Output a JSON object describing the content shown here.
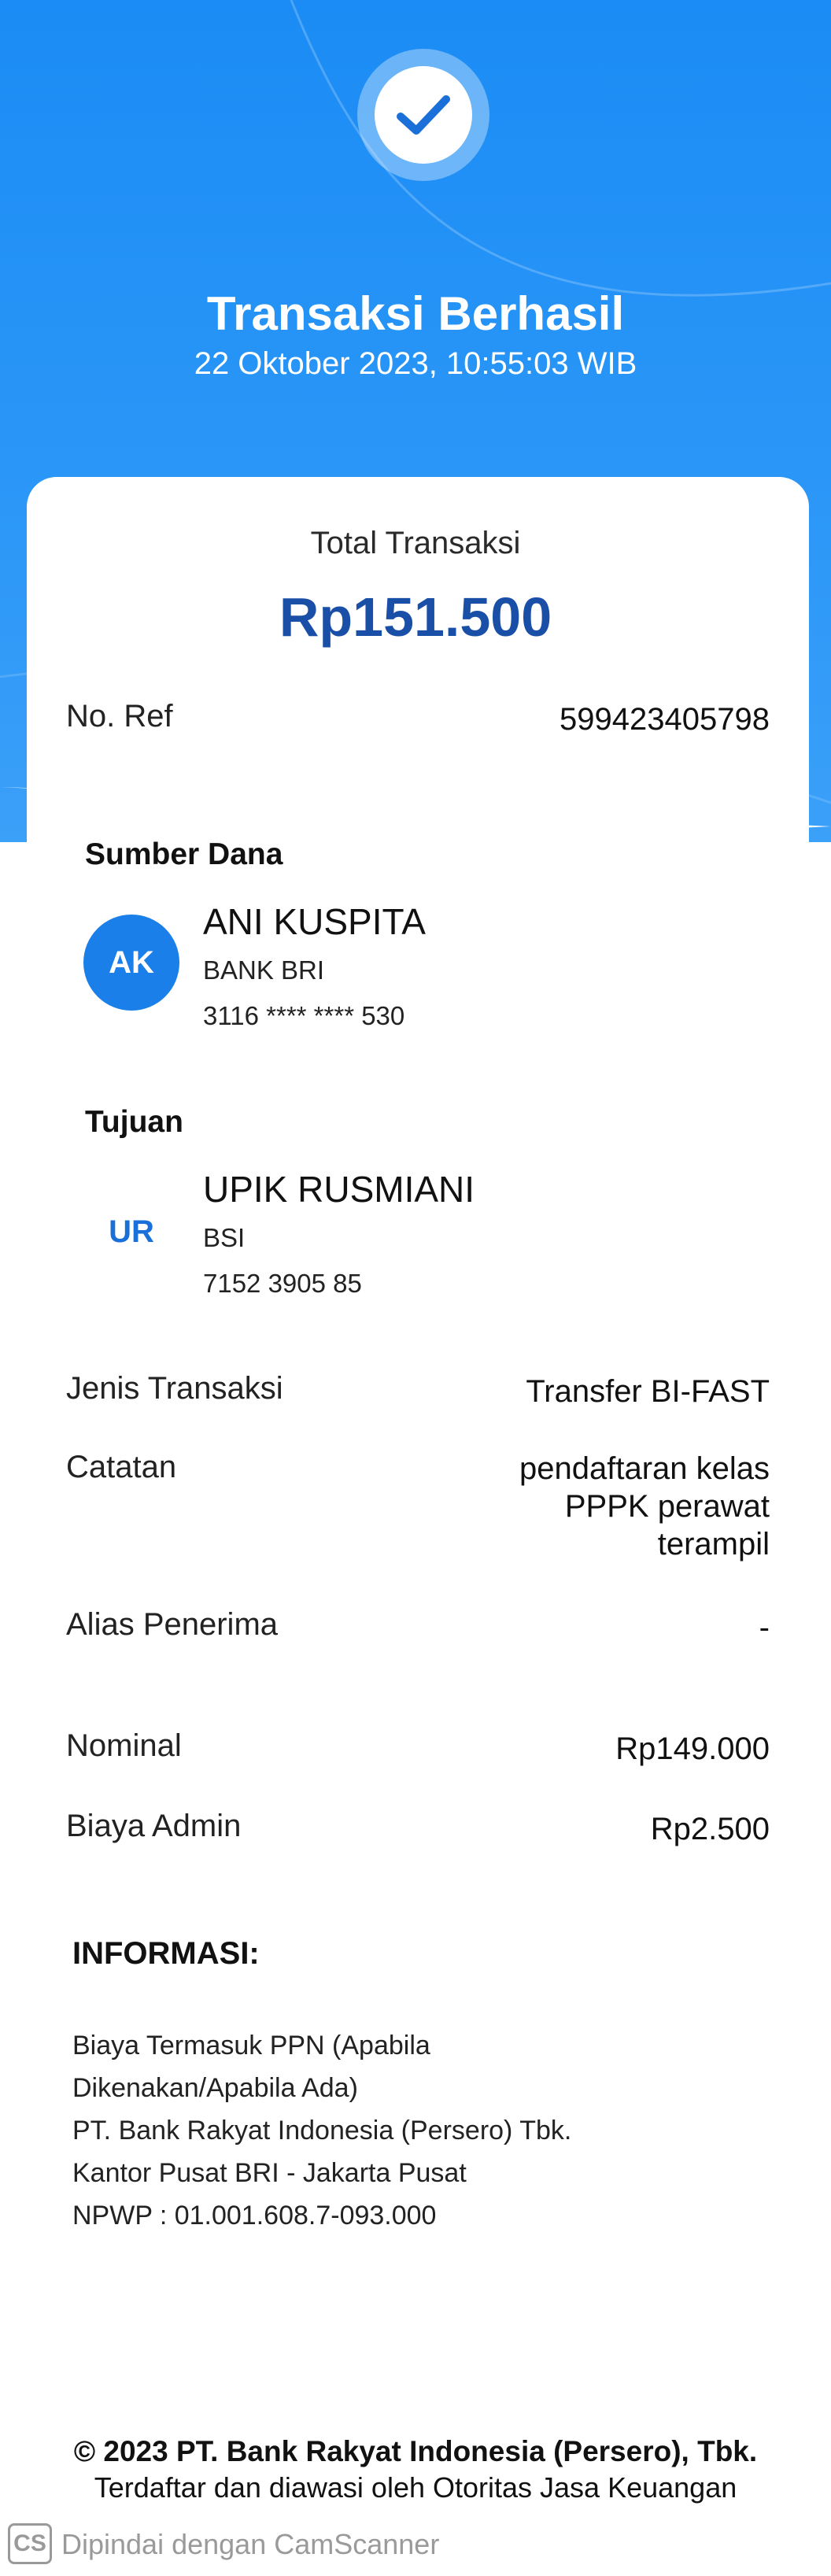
{
  "header": {
    "title": "Transaksi Berhasil",
    "datetime": "22 Oktober 2023, 10:55:03 WIB",
    "status_icon": "check-icon"
  },
  "summary": {
    "total_label": "Total Transaksi",
    "total_amount": "Rp151.500",
    "ref_label": "No. Ref",
    "ref_value": "599423405798"
  },
  "source": {
    "section_title": "Sumber Dana",
    "initials": "AK",
    "name": "ANI KUSPITA",
    "bank": "BANK BRI",
    "account": "3116 **** **** 530"
  },
  "destination": {
    "section_title": "Tujuan",
    "initials": "UR",
    "name": "UPIK RUSMIANI",
    "bank": "BSI",
    "account": "7152 3905 85"
  },
  "details": {
    "type_label": "Jenis Transaksi",
    "type_value": "Transfer BI-FAST",
    "note_label": "Catatan",
    "note_lines": [
      "pendaftaran kelas",
      "PPPK perawat",
      "terampil"
    ],
    "alias_label": "Alias Penerima",
    "alias_value": "-",
    "nominal_label": "Nominal",
    "nominal_value": "Rp149.000",
    "admin_label": "Biaya Admin",
    "admin_value": "Rp2.500"
  },
  "info": {
    "title": "INFORMASI:",
    "lines": [
      "Biaya Termasuk PPN (Apabila",
      "Dikenakan/Apabila Ada)",
      "PT. Bank Rakyat Indonesia (Persero) Tbk.",
      "Kantor Pusat BRI - Jakarta Pusat",
      "NPWP : 01.001.608.7-093.000"
    ]
  },
  "footer": {
    "copyright": "© 2023 PT. Bank Rakyat Indonesia (Persero), Tbk.",
    "regulator": "Terdaftar dan diawasi oleh Otoritas Jasa Keuangan"
  },
  "watermark": {
    "badge": "CS",
    "text": "Dipindai dengan CamScanner"
  },
  "colors": {
    "header_blue": "#1b8cf5",
    "amount_blue": "#1a4fa8",
    "avatar_blue": "#1a7fe8"
  }
}
